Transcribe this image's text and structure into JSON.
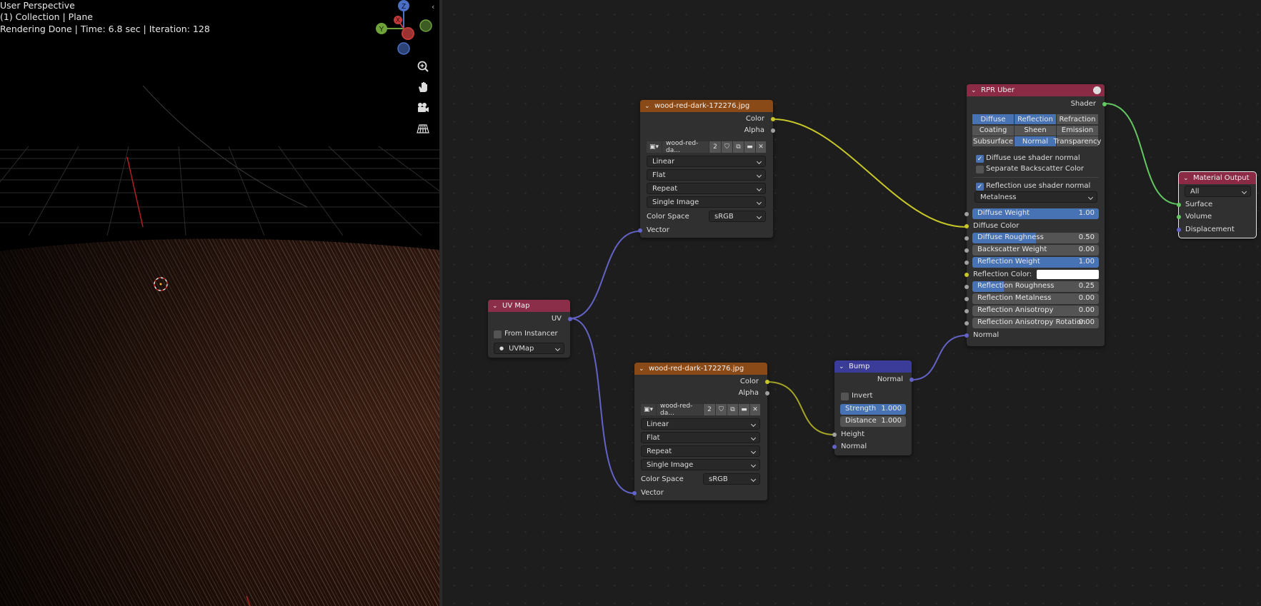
{
  "viewport": {
    "title": "User Perspective",
    "collection": "(1) Collection | Plane",
    "render_status": "Rendering Done | Time: 6.8 sec | Iteration: 128",
    "gizmo": {
      "z": "Z",
      "y": "Y",
      "x": "X"
    },
    "tools": [
      "zoom-icon",
      "hand-icon",
      "camera-icon",
      "grid-icon"
    ]
  },
  "nodes": {
    "image1": {
      "title": "wood-red-dark-172276.jpg",
      "out_color": "Color",
      "out_alpha": "Alpha",
      "image_name": "wood-red-da...",
      "users": "2",
      "interpolation": "Linear",
      "projection": "Flat",
      "extension": "Repeat",
      "source": "Single Image",
      "color_space_label": "Color Space",
      "color_space": "sRGB",
      "in_vector": "Vector"
    },
    "image2": {
      "title": "wood-red-dark-172276.jpg",
      "out_color": "Color",
      "out_alpha": "Alpha",
      "image_name": "wood-red-da...",
      "users": "2",
      "interpolation": "Linear",
      "projection": "Flat",
      "extension": "Repeat",
      "source": "Single Image",
      "color_space_label": "Color Space",
      "color_space": "sRGB",
      "in_vector": "Vector"
    },
    "uvmap": {
      "title": "UV Map",
      "out_uv": "UV",
      "from_instancer": "From Instancer",
      "map": "UVMap"
    },
    "bump": {
      "title": "Bump",
      "out_normal": "Normal",
      "invert": "Invert",
      "strength_label": "Strength",
      "strength": "1.000",
      "distance_label": "Distance",
      "distance": "1.000",
      "in_height": "Height",
      "in_normal": "Normal"
    },
    "rpr": {
      "title": "RPR Uber",
      "out_shader": "Shader",
      "tabs": [
        "Diffuse",
        "Reflection",
        "Refraction",
        "Coating",
        "Sheen",
        "Emission",
        "Subsurface",
        "Normal",
        "Transparency"
      ],
      "tabs_active": [
        true,
        true,
        false,
        false,
        false,
        false,
        false,
        true,
        false
      ],
      "diffuse_use_normal": "Diffuse use shader normal",
      "separate_backscatter": "Separate Backscatter Color",
      "reflection_use_normal": "Reflection use shader normal",
      "mode": "Metalness",
      "inputs": [
        {
          "label": "Diffuse Weight",
          "value": "1.00",
          "fill": 1.0
        },
        {
          "label": "Diffuse Roughness",
          "value": "0.50",
          "fill": 0.5
        },
        {
          "label": "Backscatter Weight",
          "value": "0.00",
          "fill": 0.0
        },
        {
          "label": "Reflection Weight",
          "value": "1.00",
          "fill": 1.0
        },
        {
          "label": "Reflection Roughness",
          "value": "0.25",
          "fill": 0.25
        },
        {
          "label": "Reflection Metalness",
          "value": "0.00",
          "fill": 0.0
        },
        {
          "label": "Reflection Anisotropy",
          "value": "0.00",
          "fill": 0.0
        },
        {
          "label": "Reflection Anisotropy Rotation",
          "value": "0.00",
          "fill": 0.0
        }
      ],
      "diffuse_color": "Diffuse Color",
      "reflection_color": "Reflection Color:",
      "in_normal": "Normal"
    },
    "output": {
      "title": "Material Output",
      "target": "All",
      "in_surface": "Surface",
      "in_volume": "Volume",
      "in_displacement": "Displacement"
    }
  },
  "colors": {
    "accent": "#4772b3",
    "image_header": "#8a4a17",
    "shader_header": "#8b2a45",
    "bump_header": "#3b3c9a",
    "wire_color": "#c7c729",
    "wire_vector": "#6363c7",
    "wire_shader": "#63c763"
  }
}
